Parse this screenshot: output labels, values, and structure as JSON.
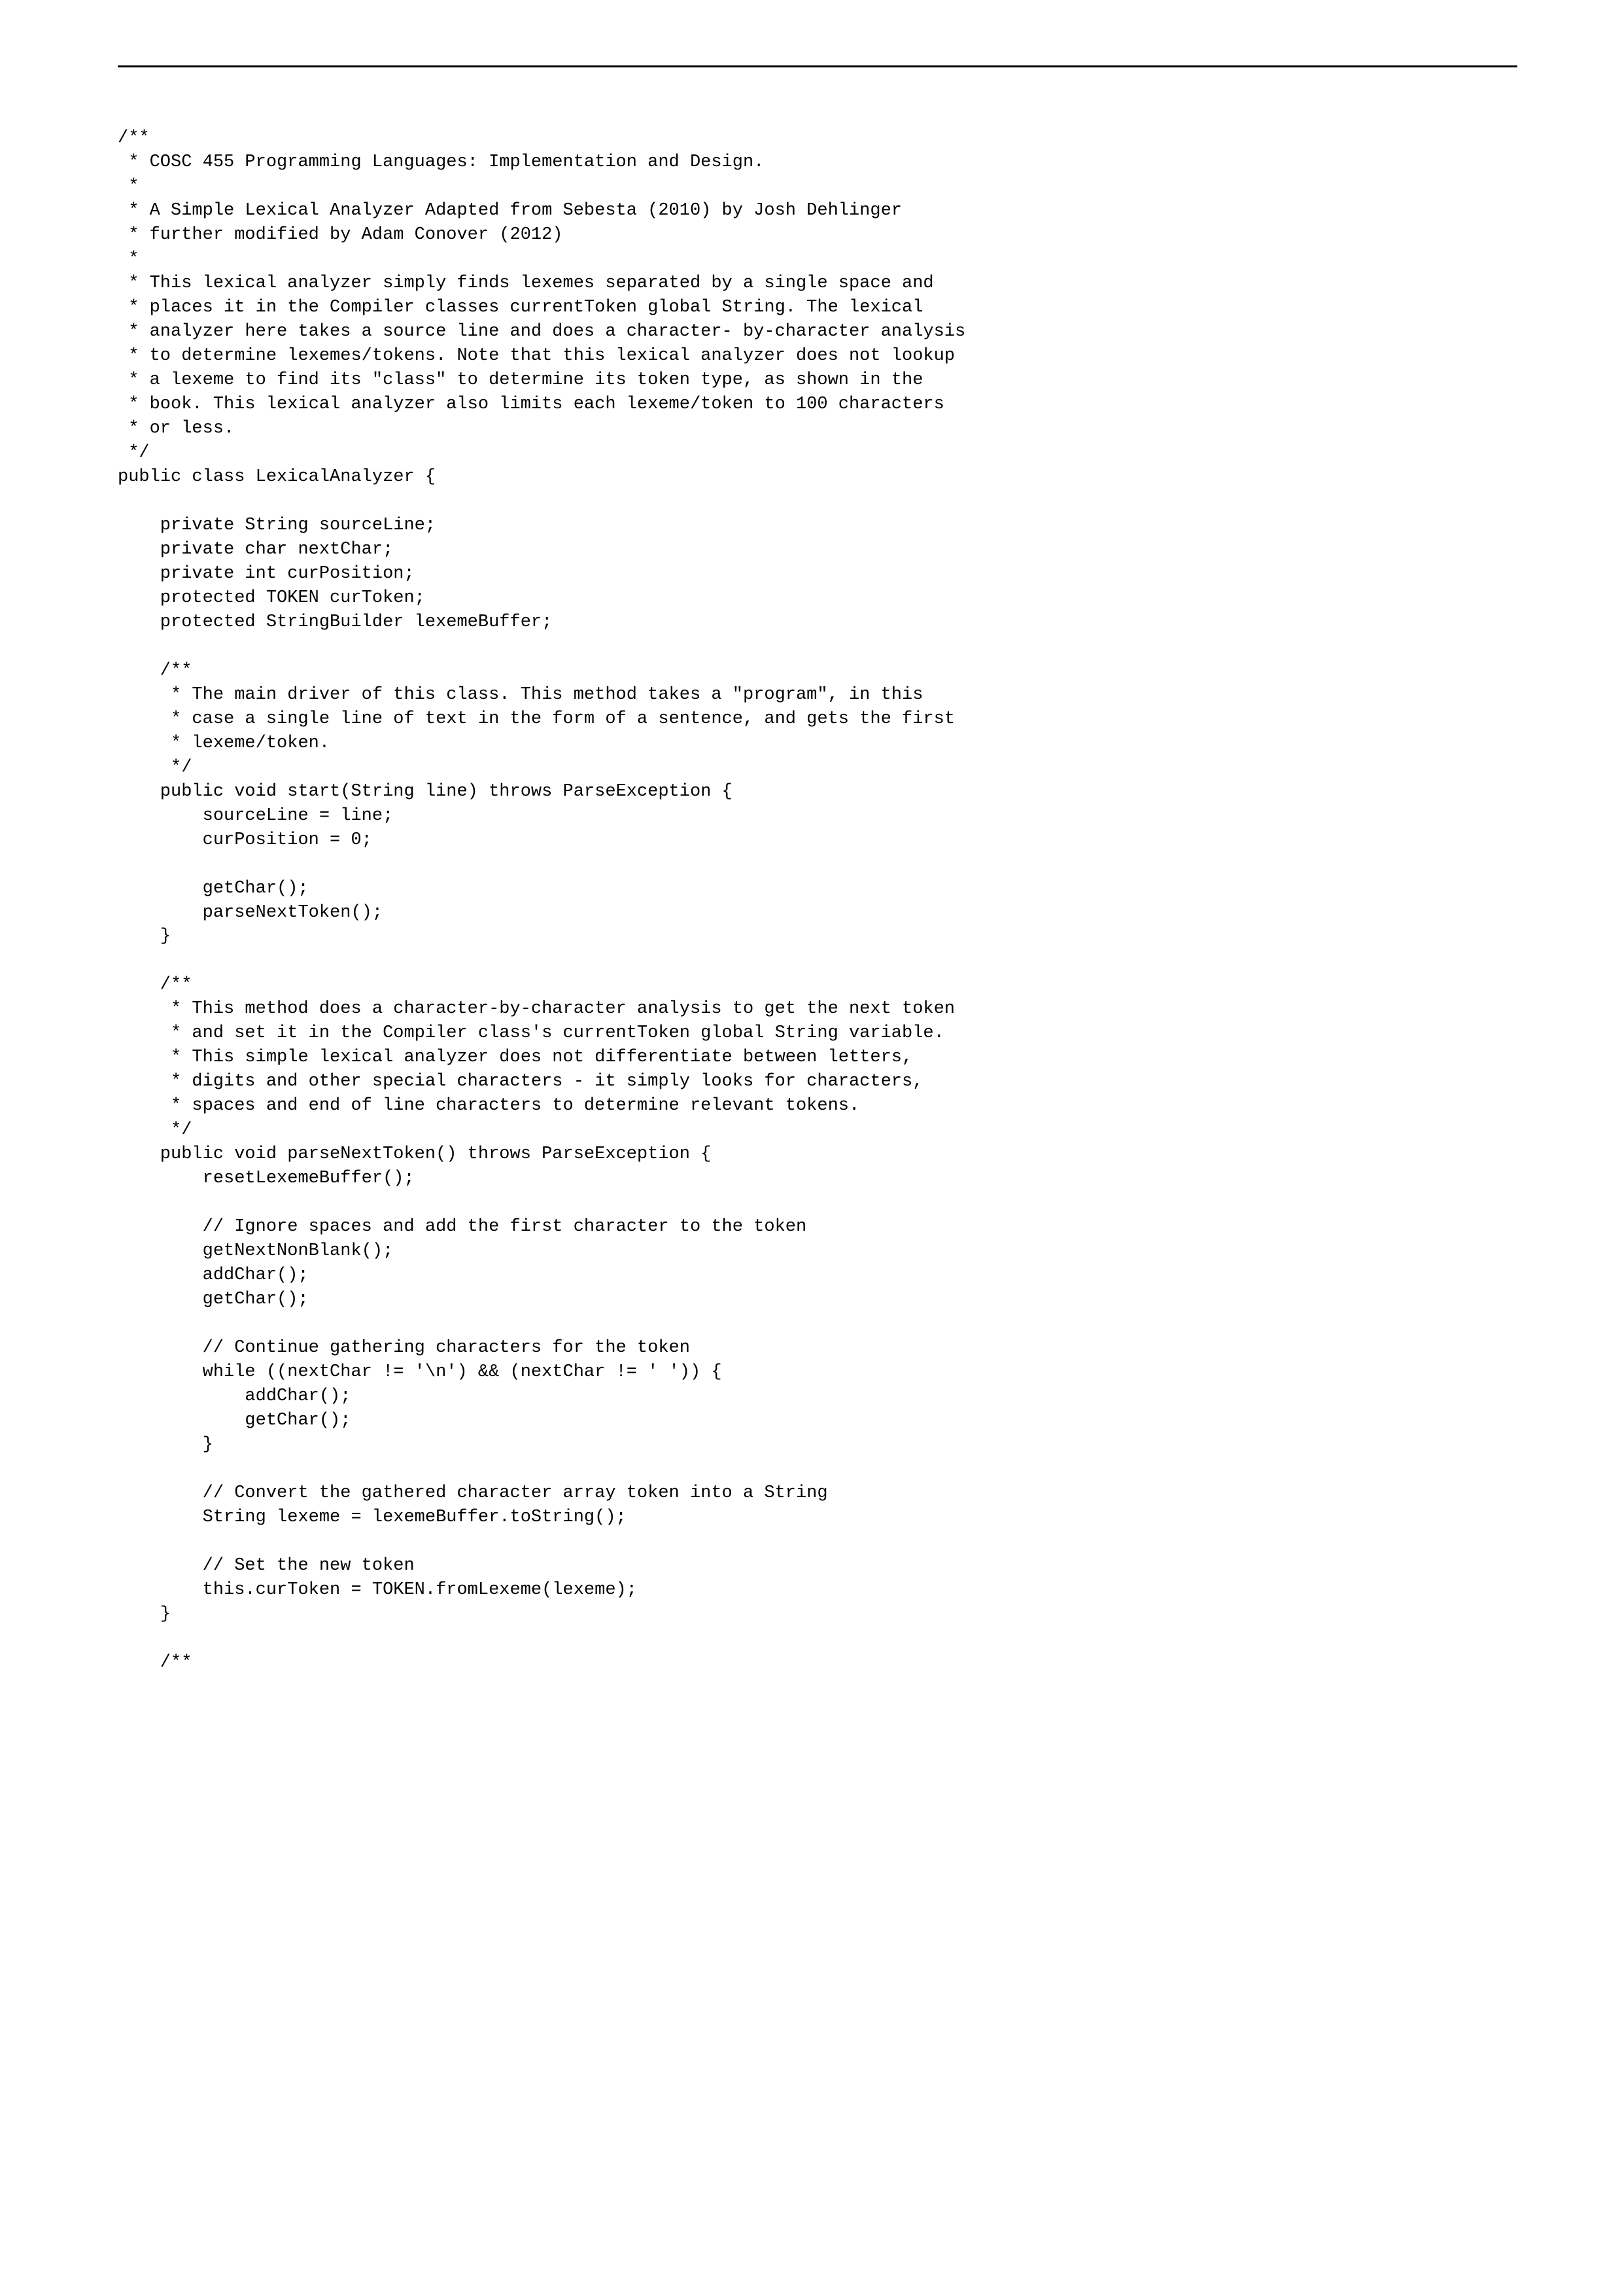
{
  "code": "/**\n * COSC 455 Programming Languages: Implementation and Design.\n *\n * A Simple Lexical Analyzer Adapted from Sebesta (2010) by Josh Dehlinger\n * further modified by Adam Conover (2012)\n *\n * This lexical analyzer simply finds lexemes separated by a single space and\n * places it in the Compiler classes currentToken global String. The lexical\n * analyzer here takes a source line and does a character- by-character analysis\n * to determine lexemes/tokens. Note that this lexical analyzer does not lookup\n * a lexeme to find its \"class\" to determine its token type, as shown in the\n * book. This lexical analyzer also limits each lexeme/token to 100 characters\n * or less.\n */\npublic class LexicalAnalyzer {\n\n    private String sourceLine;\n    private char nextChar;\n    private int curPosition;\n    protected TOKEN curToken;\n    protected StringBuilder lexemeBuffer;\n\n    /**\n     * The main driver of this class. This method takes a \"program\", in this\n     * case a single line of text in the form of a sentence, and gets the first\n     * lexeme/token.\n     */\n    public void start(String line) throws ParseException {\n        sourceLine = line;\n        curPosition = 0;\n\n        getChar();\n        parseNextToken();\n    }\n\n    /**\n     * This method does a character-by-character analysis to get the next token\n     * and set it in the Compiler class's currentToken global String variable.\n     * This simple lexical analyzer does not differentiate between letters,\n     * digits and other special characters - it simply looks for characters,\n     * spaces and end of line characters to determine relevant tokens.\n     */\n    public void parseNextToken() throws ParseException {\n        resetLexemeBuffer();\n\n        // Ignore spaces and add the first character to the token\n        getNextNonBlank();\n        addChar();\n        getChar();\n\n        // Continue gathering characters for the token\n        while ((nextChar != '\\n') && (nextChar != ' ')) {\n            addChar();\n            getChar();\n        }\n\n        // Convert the gathered character array token into a String\n        String lexeme = lexemeBuffer.toString();\n\n        // Set the new token\n        this.curToken = TOKEN.fromLexeme(lexeme);\n    }\n\n    /**"
}
